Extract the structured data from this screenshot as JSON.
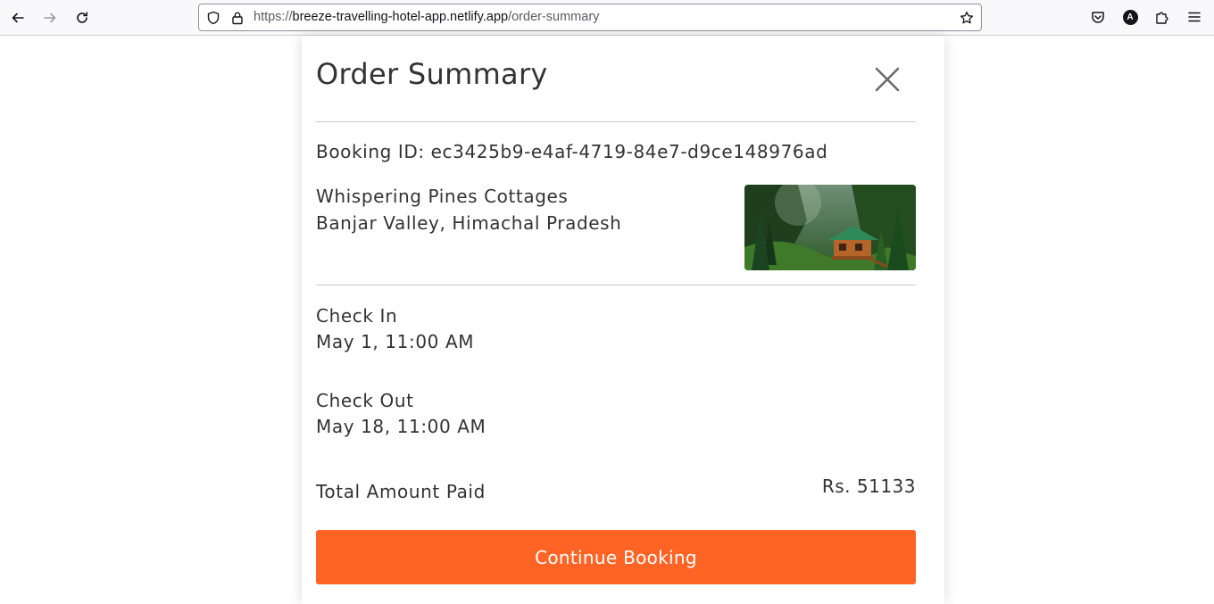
{
  "browser": {
    "url_protocol": "https://",
    "url_domain": "breeze-travelling-hotel-app.netlify.app",
    "url_path": "/order-summary",
    "profile_initial": "A"
  },
  "order": {
    "title": "Order Summary",
    "booking_id_text": "Booking ID: ec3425b9-e4af-4719-84e7-d9ce148976ad",
    "hotel_name": "Whispering Pines Cottages",
    "hotel_location": "Banjar Valley, Himachal Pradesh",
    "check_in_label": "Check In",
    "check_in_value": "May 1, 11:00 AM",
    "check_out_label": "Check Out",
    "check_out_value": "May 18, 11:00 AM",
    "total_label": "Total Amount Paid",
    "total_value": "Rs. 51133",
    "cta_label": "Continue Booking"
  },
  "colors": {
    "accent": "#ff6424",
    "text": "#333333",
    "divider": "#cccccc"
  }
}
